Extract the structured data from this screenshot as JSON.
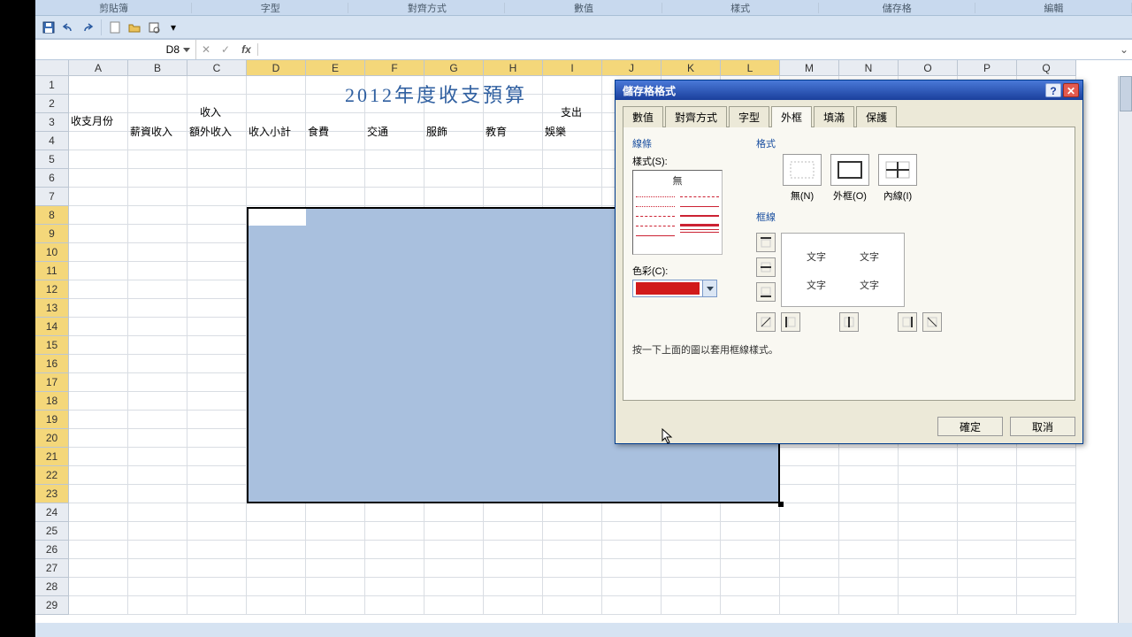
{
  "ribbon_groups": [
    "剪貼簿",
    "字型",
    "對齊方式",
    "數值",
    "樣式",
    "儲存格",
    "編輯"
  ],
  "namebox": "D8",
  "formula": "",
  "columns": [
    "A",
    "B",
    "C",
    "D",
    "E",
    "F",
    "G",
    "H",
    "I",
    "J",
    "K",
    "L",
    "M",
    "N",
    "O",
    "P",
    "Q"
  ],
  "selected_cols_start": 3,
  "selected_cols_end": 11,
  "rows": [
    "1",
    "2",
    "3",
    "4",
    "5",
    "6",
    "7",
    "8",
    "9",
    "10",
    "11",
    "12",
    "13",
    "14",
    "15",
    "16",
    "17",
    "18",
    "19",
    "20",
    "21",
    "22",
    "23",
    "24",
    "25",
    "26",
    "27",
    "28",
    "29"
  ],
  "selected_rows_start": 7,
  "selected_rows_end": 22,
  "sheet": {
    "title": "2012年度收支預算",
    "r2": {
      "a": "收支月份",
      "income": "收入",
      "expense": "支出"
    },
    "r3": {
      "b": "薪資收入",
      "c": "額外收入",
      "d": "收入小計",
      "e": "食費",
      "f": "交通",
      "g": "服飾",
      "h": "教育",
      "i": "娛樂"
    }
  },
  "dialog": {
    "title": "儲存格格式",
    "tabs": [
      "數值",
      "對齊方式",
      "字型",
      "外框",
      "填滿",
      "保護"
    ],
    "active_tab": 3,
    "line_section": "線條",
    "style_label": "樣式(S):",
    "style_none": "無",
    "color_label": "色彩(C):",
    "color_value": "#d11a1a",
    "format_section": "格式",
    "presets": [
      {
        "label": "無(N)"
      },
      {
        "label": "外框(O)"
      },
      {
        "label": "內線(I)"
      }
    ],
    "border_section": "框線",
    "preview_text": "文字",
    "hint": "按一下上面的圖以套用框線樣式。",
    "ok": "確定",
    "cancel": "取消"
  }
}
